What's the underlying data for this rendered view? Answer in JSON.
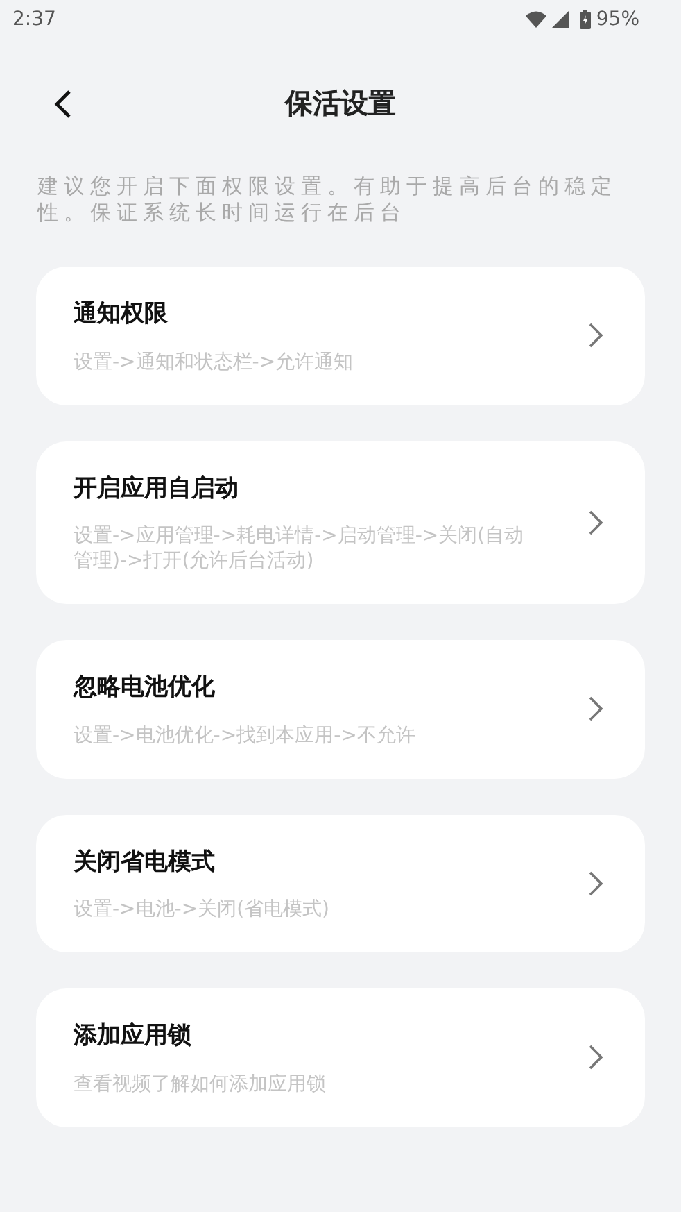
{
  "status_bar": {
    "time": "2:37",
    "battery": "95%"
  },
  "header": {
    "title": "保活设置"
  },
  "description": "建议您开启下面权限设置。有助于提高后台的稳定性。保证系统长时间运行在后台",
  "items": [
    {
      "title": "通知权限",
      "subtitle": "设置->通知和状态栏->允许通知"
    },
    {
      "title": "开启应用自启动",
      "subtitle": "设置->应用管理->耗电详情->启动管理->关闭(自动管理)->打开(允许后台活动)"
    },
    {
      "title": "忽略电池优化",
      "subtitle": "设置->电池优化->找到本应用->不允许"
    },
    {
      "title": "关闭省电模式",
      "subtitle": "设置->电池->关闭(省电模式)"
    },
    {
      "title": "添加应用锁",
      "subtitle": "查看视频了解如何添加应用锁"
    }
  ]
}
